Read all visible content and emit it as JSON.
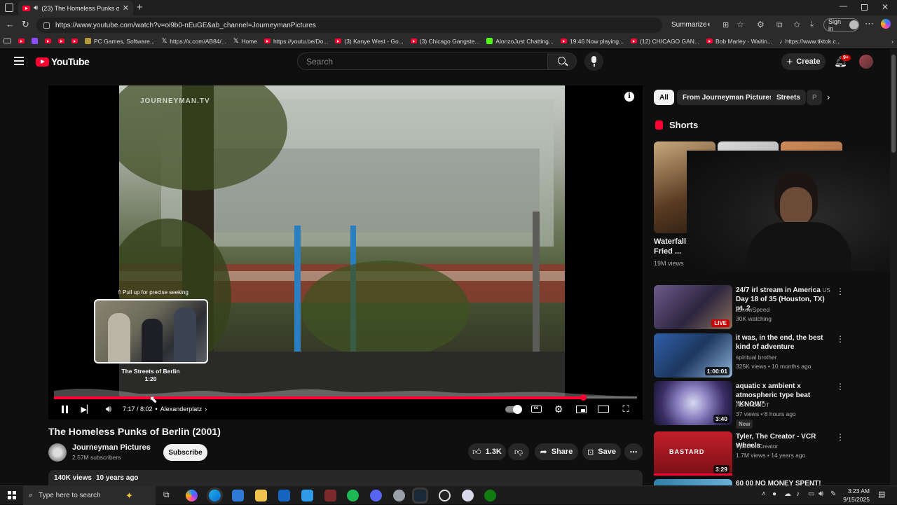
{
  "browser": {
    "tab_title": "(23) The Homeless Punks of",
    "url": "https://www.youtube.com/watch?v=oi9b0-nEuGE&ab_channel=JourneymanPictures",
    "summarize_label": "Summarize",
    "sign_in_label": "Sign in",
    "bookmarks": [
      "PC Games, Software...",
      "https://x.com/AB84/...",
      "Home",
      "https://youtu.be/Do...",
      "(3) Kanye West - Go...",
      "(3) Chicago Gangste...",
      "AlonzoJust Chatting...",
      "19:46 Now playing...",
      "(12) CHICAGO GAN...",
      "Bob Marley - Waitin...",
      "https://www.tiktok.c..."
    ]
  },
  "youtube": {
    "logo_text": "YouTube",
    "search_placeholder": "Search",
    "create_label": "Create",
    "notification_count": "9+"
  },
  "player": {
    "watermark": "JOURNEYMAN.TV",
    "seek_hint": "Pull up for precise seeking",
    "preview_chapter": "The Streets of Berlin",
    "preview_time": "1:20",
    "time_display": "7:17 / 8:02",
    "separator": "•",
    "chapter": "Alexanderplatz",
    "progress_fraction": 0.908
  },
  "video": {
    "title": "The Homeless Punks of Berlin (2001)",
    "channel_name": "Journeyman Pictures",
    "subscribers": "2.57M subscribers",
    "subscribe_label": "Subscribe",
    "likes": "1.3K",
    "share_label": "Share",
    "save_label": "Save",
    "views": "140K views",
    "uploaded": "10 years ago"
  },
  "sidebar": {
    "chips": [
      "All",
      "From Journeyman Pictures",
      "Streets",
      "P"
    ],
    "shorts_heading": "Shorts",
    "short_title_line1": "Waterfall",
    "short_title_line2": "Fried ...",
    "short_views": "19M views",
    "recommendations": [
      {
        "title": "24/7 irl stream in America",
        "region": "US",
        "title2": "Day 18 of 35 (Houston, TX) pt. 2",
        "channel": "IShowSpeed",
        "meta": "30K watching",
        "badge": "LIVE"
      },
      {
        "title": "it was, in the end, the best kind of adventure",
        "channel": "spiritual brother",
        "meta": "325K views • 10 months ago",
        "duration": "1:00:01"
      },
      {
        "title": "aquatic x ambient x atmospheric type beat \"KNOW\"",
        "channel": "ASTROMOT",
        "meta": "37 views • 8 hours ago",
        "duration": "3:40",
        "badge": "New"
      },
      {
        "title": "Tyler, The Creator - VCR Wheels",
        "channel": "TylerTehCreator",
        "meta": "1.7M views • 14 years ago",
        "duration": "3:29",
        "thumb_text": "BASTARD"
      },
      {
        "title": "60 00 NO MONEY SPENT!"
      }
    ]
  },
  "taskbar": {
    "search_placeholder": "Type here to search",
    "time": "3:23 AM",
    "date": "9/15/2025"
  },
  "colors": {
    "accent": "#ff0033",
    "background": "#0f0f0f",
    "surface": "#272727"
  }
}
